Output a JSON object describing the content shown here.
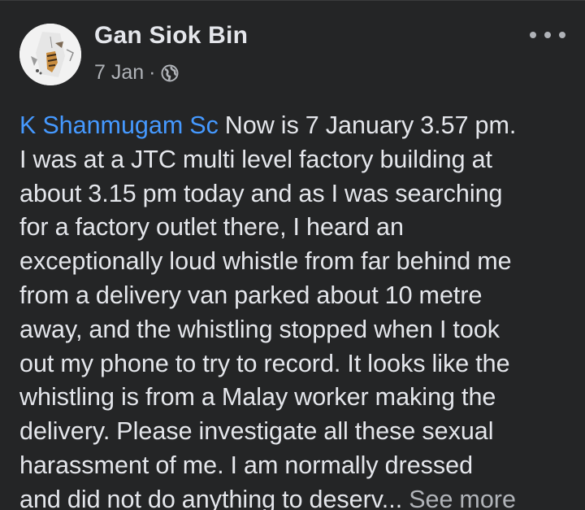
{
  "post": {
    "author": "Gan Siok Bin",
    "date": "7 Jan",
    "separator": "·",
    "mention": "K Shanmugam Sc",
    "text_lines": [
      " Now is 7 January 3.57 pm.",
      "I was at a JTC multi level factory building at",
      "about 3.15 pm today and as I was searching",
      "for a factory outlet there, I heard an",
      "exceptionally loud whistle from far behind me",
      "from a delivery van parked about 10 metre",
      "away, and the whistling stopped when I took",
      "out my phone to try to record. It looks like the",
      "whistling is from a Malay worker making the",
      "delivery. Please investigate all these sexual",
      "harassment of me. I am normally  dressed",
      "and did not do anything to deserv..."
    ],
    "see_more": " See more",
    "privacy_icon": "globe-icon",
    "more_icon": "more-options-icon"
  },
  "colors": {
    "background": "#242526",
    "primary_text": "#e4e6eb",
    "secondary_text": "#b0b3b8",
    "mention": "#4599ff"
  }
}
